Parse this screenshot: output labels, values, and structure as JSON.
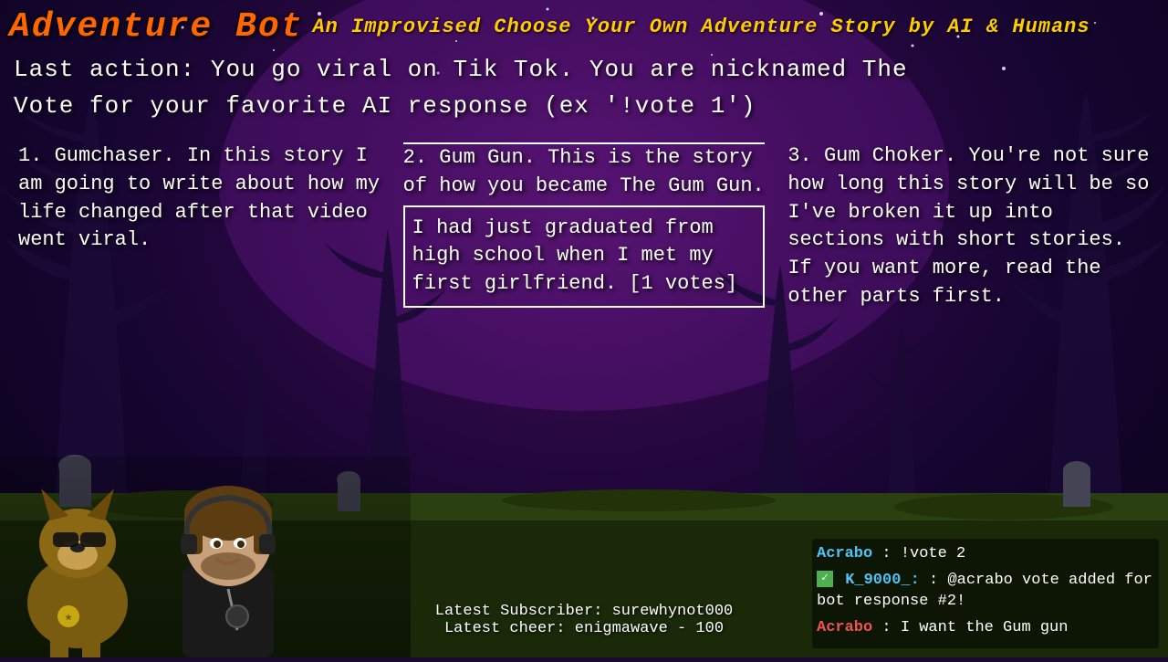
{
  "header": {
    "title": "Adventure Bot",
    "subtitle": "An Improvised Choose Your Own Adventure Story by AI & Humans"
  },
  "last_action": {
    "label": "Last action:",
    "text": "You go viral on Tik Tok. You are nicknamed The"
  },
  "vote_instruction": "Vote for your favorite AI response (ex '!vote 1')",
  "options": [
    {
      "number": "1.",
      "title": "Gumchaser.",
      "body": "In this story I am going to write about how my life changed after that video went viral."
    },
    {
      "number": "2.",
      "title": "Gum Gun.",
      "intro": "This is the story of how you became The Gum Gun.",
      "body": "I had just graduated from high school when I met my first girlfriend. [1 votes]"
    },
    {
      "number": "3.",
      "title": "Gum Choker.",
      "body": "You're not sure how long this story will be so I've broken it up into sections with short stories. If you want more, read the other parts first."
    }
  ],
  "subscriber_info": {
    "latest_subscriber_label": "Latest Subscriber:",
    "latest_subscriber": "surewhynot000",
    "latest_cheer_label": "Latest cheer:",
    "latest_cheer": "enigmawave - 100"
  },
  "chat": [
    {
      "username": "Acrabo",
      "username_color": "blue",
      "message": "!vote 2",
      "verified": false
    },
    {
      "username": "K_9000_:",
      "username_color": "green",
      "message": "@acrabo vote added for bot response #2!",
      "verified": true
    },
    {
      "username": "Acrabo",
      "username_color": "red",
      "message": "I want the Gum gun",
      "verified": false
    }
  ],
  "colors": {
    "title_color": "#ff6600",
    "subtitle_color": "#ffcc00",
    "text_color": "#ffffff",
    "option2_highlight": "#ffffff"
  }
}
